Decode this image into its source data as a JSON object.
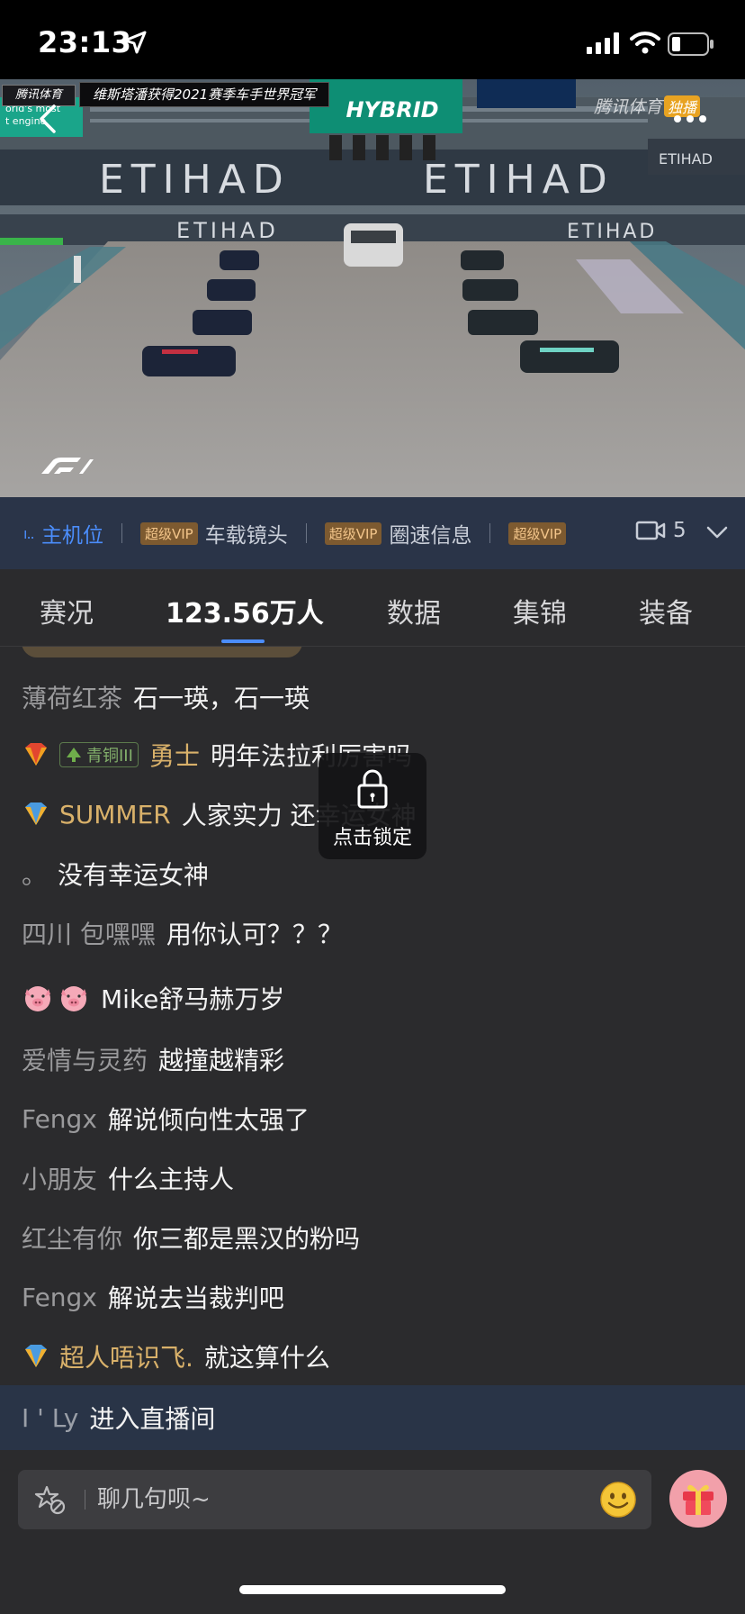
{
  "status_bar": {
    "time": "23:13",
    "icons": [
      "location-arrow-icon",
      "cellular-signal-icon",
      "wifi-icon",
      "battery-icon"
    ]
  },
  "video": {
    "headline": "维斯塔潘获得2021赛季车手世界冠军",
    "channel_logo": "腾讯体育",
    "watermark": "腾讯体育",
    "watermark_badge": "独播",
    "track_banners": [
      "ETIHAD",
      "ETIHAD",
      "ETIHAD",
      "ETIHAD",
      "ETIHAD"
    ],
    "overlay_sign": "HYBRID",
    "sign_left_line1": "orld's most",
    "sign_left_line2": "t engine"
  },
  "camera_bar": {
    "active": "主机位",
    "items": [
      {
        "badge": "超级VIP",
        "label": "车载镜头"
      },
      {
        "badge": "超级VIP",
        "label": "圈速信息"
      },
      {
        "badge": "超级VIP",
        "label": ""
      }
    ],
    "camera_count": "5"
  },
  "tabs": [
    {
      "label": "赛况",
      "active": false
    },
    {
      "label": "123.56万人",
      "active": true
    },
    {
      "label": "数据",
      "active": false
    },
    {
      "label": "集锦",
      "active": false
    },
    {
      "label": "装备",
      "active": false
    }
  ],
  "chat": {
    "messages": [
      {
        "nick": "薄荷红茶",
        "text": "石一瑛，石一瑛"
      },
      {
        "rank": "red-diamond",
        "level": "青铜III",
        "nick": "勇士",
        "text": "明年法拉利厉害吗"
      },
      {
        "rank": "blue-diamond",
        "nick": "SUMMER",
        "text": "人家实力 还幸运女神"
      },
      {
        "nick": "。",
        "text": "没有幸运女神"
      },
      {
        "nick": "四川 包嘿嘿",
        "text": "用你认可？？？"
      },
      {
        "nick": "🐷🐷",
        "text": "Mike舒马赫万岁"
      },
      {
        "nick": "爱情与灵药",
        "text": "越撞越精彩"
      },
      {
        "nick": "Fengx",
        "text": "解说倾向性太强了"
      },
      {
        "nick": "小朋友",
        "text": "什么主持人"
      },
      {
        "nick": "红尘有你",
        "text": "你三都是黑汉的粉吗"
      },
      {
        "nick": "Fengx",
        "text": "解说去当裁判吧"
      },
      {
        "rank": "blue-diamond",
        "nick": "超人唔识飞.",
        "text": "就这算什么"
      }
    ],
    "enter": {
      "nick": "I ' Ly",
      "text": "进入直播间"
    }
  },
  "lock_overlay": {
    "label": "点击锁定"
  },
  "input": {
    "placeholder": "聊几句呗~"
  },
  "colors": {
    "accent_blue": "#4b8dfb",
    "vip_badge_bg": "#7d5a30",
    "vip_badge_text": "#f3c58a",
    "gold_nick": "#d9b16a",
    "camera_bar_bg": "#2a3448",
    "page_bg": "#2b2b2d"
  }
}
